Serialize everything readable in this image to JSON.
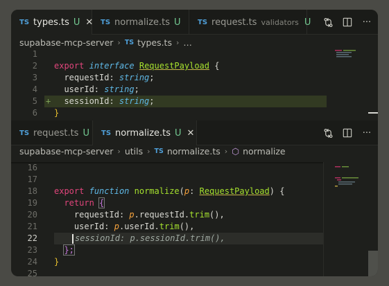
{
  "top_pane": {
    "tabs": [
      {
        "icon": "TS",
        "name": "types.ts",
        "dir": "",
        "status": "U",
        "close": "✕",
        "active": true
      },
      {
        "icon": "TS",
        "name": "normalize.ts",
        "dir": "",
        "status": "U",
        "close": "",
        "active": false
      },
      {
        "icon": "TS",
        "name": "request.ts",
        "dir": "validators",
        "status": "U",
        "close": "",
        "active": false
      }
    ],
    "breadcrumb": {
      "root": "supabase-mcp-server",
      "sep": "›",
      "file": "types.ts",
      "more": "…"
    },
    "lines": [
      {
        "n": "1",
        "code": ""
      },
      {
        "n": "2",
        "code": "export interface RequestPayload {"
      },
      {
        "n": "3",
        "code": "  requestId: string;"
      },
      {
        "n": "4",
        "code": "  userId: string;"
      },
      {
        "n": "5",
        "code": "  sessionId: string;"
      },
      {
        "n": "6",
        "code": "}"
      }
    ],
    "gutter_add_marker": "+"
  },
  "bottom_pane": {
    "tabs": [
      {
        "icon": "TS",
        "name": "request.ts",
        "status": "U",
        "close": "",
        "active": false
      },
      {
        "icon": "TS",
        "name": "normalize.ts",
        "status": "U",
        "close": "✕",
        "active": true
      }
    ],
    "breadcrumb": {
      "root": "supabase-mcp-server",
      "sep": "›",
      "folder": "utils",
      "icon": "TS",
      "file": "normalize.ts",
      "symbol": "normalize"
    },
    "lines": [
      {
        "n": "16"
      },
      {
        "n": "17"
      },
      {
        "n": "18"
      },
      {
        "n": "19"
      },
      {
        "n": "20"
      },
      {
        "n": "21"
      },
      {
        "n": "22"
      },
      {
        "n": "23"
      },
      {
        "n": "24"
      },
      {
        "n": "25"
      }
    ],
    "code": {
      "l18": [
        "export",
        "function",
        "normalize",
        "(",
        "p",
        ":",
        "RequestPayload",
        ") {"
      ],
      "l19": [
        "return",
        "{"
      ],
      "l20": [
        "requestId",
        ":",
        "p",
        ".",
        "requestId",
        ".",
        "trim",
        "(),"
      ],
      "l21": [
        "userId",
        ":",
        "p",
        ".",
        "userId",
        ".",
        "trim",
        "(),"
      ],
      "l22": [
        "sessionId: p.sessionId.trim(),"
      ],
      "l23": [
        "};"
      ],
      "l24": [
        "}"
      ]
    }
  },
  "icons": {
    "compare": "compare-changes-icon",
    "split": "split-editor-icon",
    "more": "more-actions-icon"
  },
  "more_glyph": "···",
  "colors": {
    "keyword": "#e0457b",
    "function": "#a6e22e",
    "type": "#5fb8e6",
    "param": "#f6a23c",
    "diff_added": "#323a22"
  }
}
